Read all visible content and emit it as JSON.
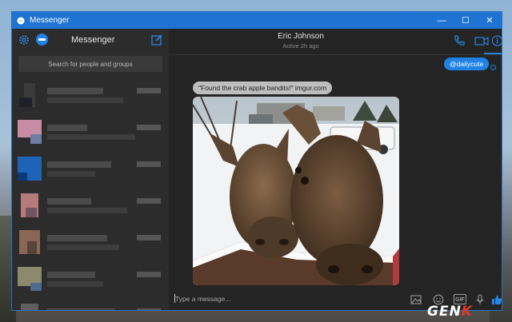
{
  "window": {
    "title": "Messenger",
    "controls": [
      "—",
      "☐",
      "✕"
    ]
  },
  "sidebar": {
    "title": "Messenger",
    "search_placeholder": "Search for people and groups",
    "contacts": [
      {
        "avatar_colors": [
          "#3b3b3b",
          "#202028"
        ]
      },
      {
        "avatar_colors": [
          "#c88da4",
          "#6f7fa3"
        ]
      },
      {
        "avatar_colors": [
          "#1f63b6",
          "#0a3a7a"
        ]
      },
      {
        "avatar_colors": [
          "#b67a78",
          "#6f5560"
        ]
      },
      {
        "avatar_colors": [
          "#8a6656",
          "#58433b"
        ]
      },
      {
        "avatar_colors": [
          "#8c8a6c",
          "#4f6a8f"
        ]
      },
      {
        "avatar_colors": [
          "#5f5f5f",
          "#3c3c3c"
        ]
      }
    ]
  },
  "chat": {
    "contact_name": "Eric Johnson",
    "contact_status": "Active 2h ago"
  },
  "messages": {
    "outgoing": "@dailycute",
    "incoming": "\"Found the crab apple bandits!\" imgur.com"
  },
  "composer": {
    "placeholder": "Type a message...",
    "gif_label": "GIF"
  },
  "watermark": {
    "text_a": "GEN",
    "text_b": "K"
  },
  "colors": {
    "accent": "#1e82e6",
    "titlebar": "#1e73d3",
    "sidebar_bg": "#2c2c2c",
    "chat_bg": "#242424"
  }
}
